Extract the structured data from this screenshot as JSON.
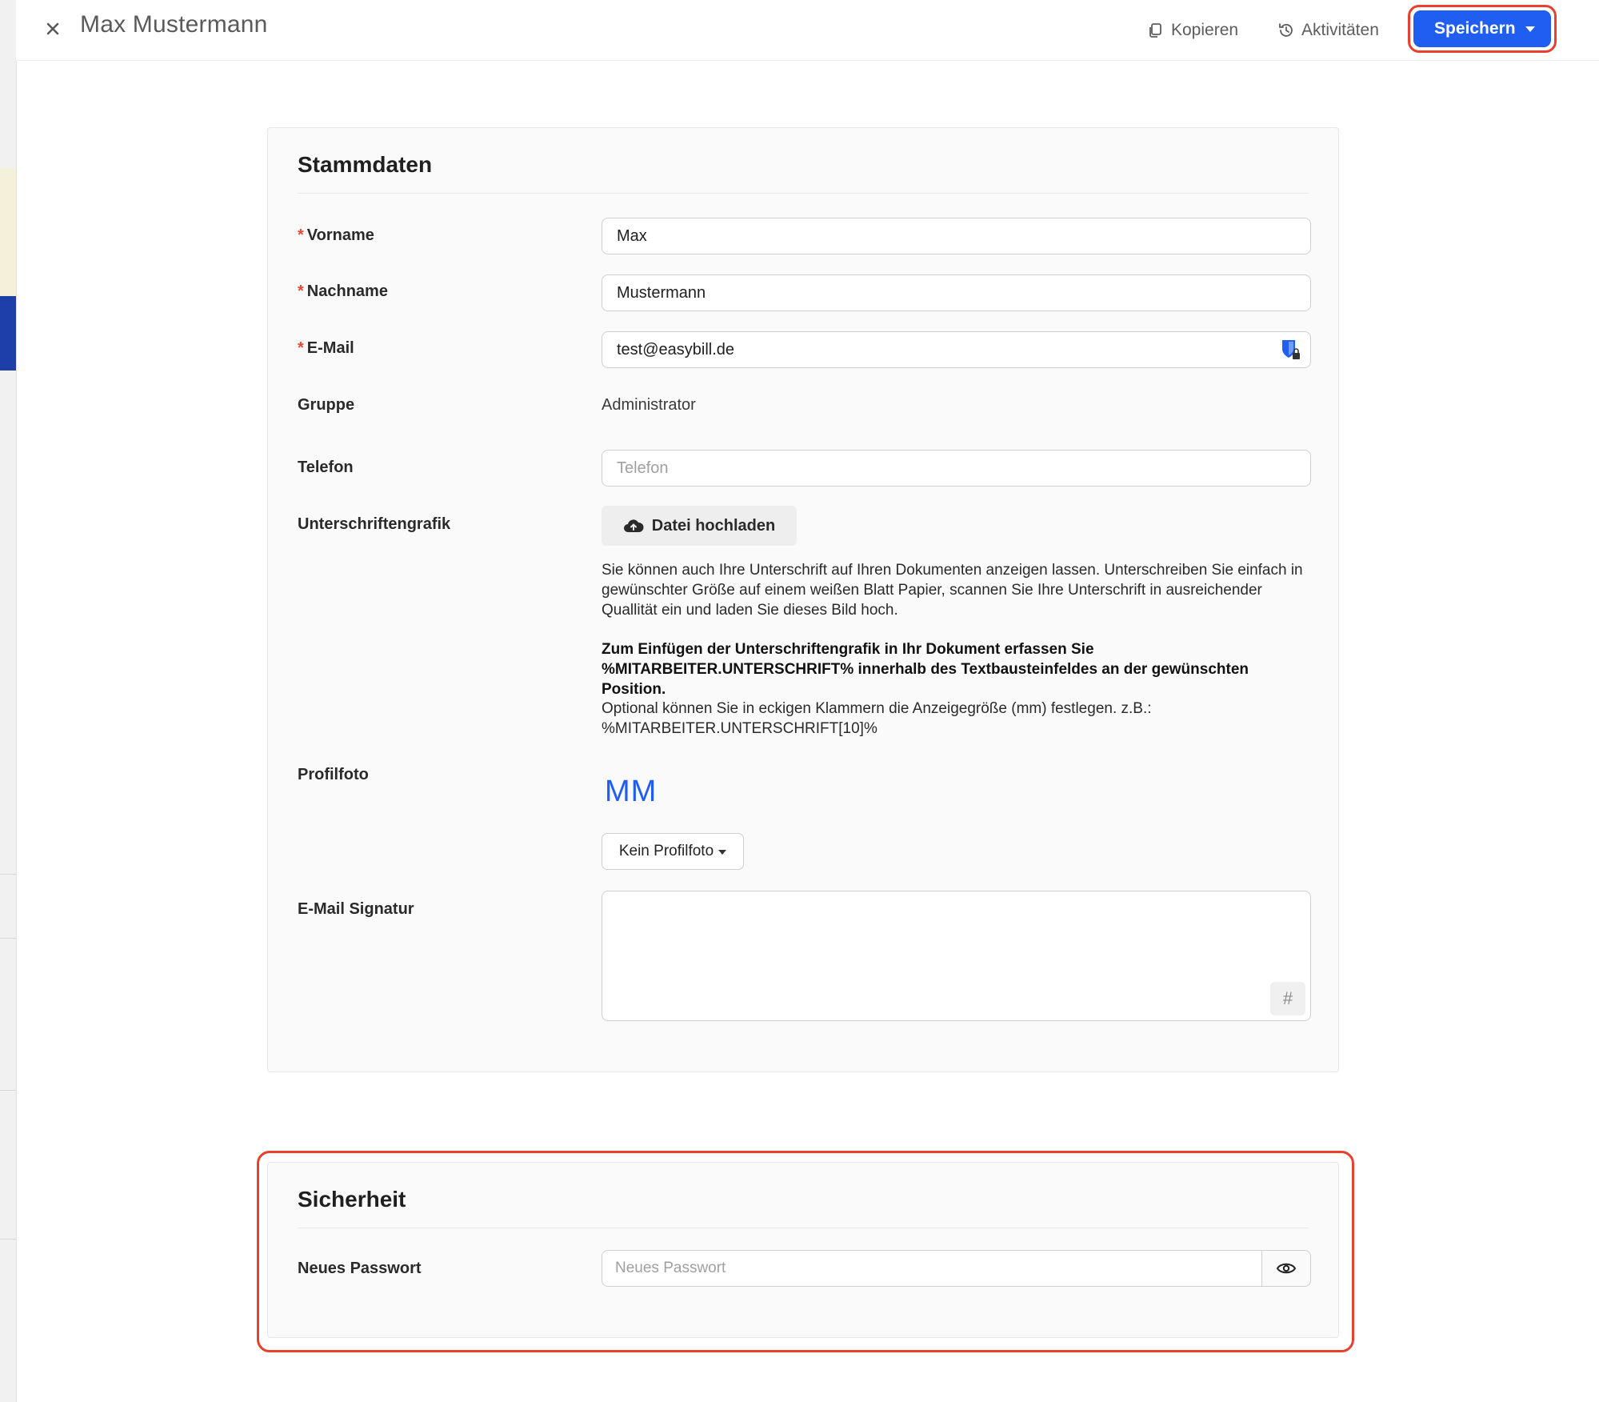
{
  "window": {
    "title": "Max Mustermann"
  },
  "toolbar": {
    "copy_label": "Kopieren",
    "activity_label": "Aktivitäten",
    "save_label": "Speichern"
  },
  "stammdaten": {
    "title": "Stammdaten",
    "required_marker": "*",
    "vorname": {
      "label": "Vorname",
      "value": "Max"
    },
    "nachname": {
      "label": "Nachname",
      "value": "Mustermann"
    },
    "email": {
      "label": "E-Mail",
      "value": "test@easybill.de"
    },
    "gruppe": {
      "label": "Gruppe",
      "value": "Administrator"
    },
    "telefon": {
      "label": "Telefon",
      "placeholder": "Telefon",
      "value": ""
    },
    "signature_graphic": {
      "label": "Unterschriftengrafik",
      "upload_label": "Datei hochladen",
      "help_text": "Sie können auch Ihre Unterschrift auf Ihren Dokumenten anzeigen lassen. Unterschreiben Sie einfach in gewünschter Größe auf einem weißen Blatt Papier, scannen Sie Ihre Unterschrift in ausreichender Quallität ein und laden Sie dieses Bild hoch.",
      "help_bold": "Zum Einfügen der Unterschriftengrafik in Ihr Dokument erfassen Sie %MITARBEITER.UNTERSCHRIFT% innerhalb des Textbausteinfeldes an der gewünschten Position.",
      "help_optional": "Optional können Sie in eckigen Klammern die Anzeigegröße (mm) festlegen. z.B.: %MITARBEITER.UNTERSCHRIFT[10]%"
    },
    "profilfoto": {
      "label": "Profilfoto",
      "initials": "MM",
      "dropdown_label": "Kein Profilfoto"
    },
    "email_signature": {
      "label": "E-Mail Signatur",
      "value": "",
      "hash_label": "#"
    }
  },
  "sicherheit": {
    "title": "Sicherheit",
    "password": {
      "label": "Neues Passwort",
      "placeholder": "Neues Passwort"
    }
  },
  "colors": {
    "accent": "#1f5ef0",
    "highlight": "#e8402e",
    "required": "#e34a35"
  },
  "icons": [
    "close-icon",
    "copy-icon",
    "history-icon",
    "chevron-down-icon",
    "password-manager-icon",
    "cloud-upload-icon",
    "eye-icon"
  ]
}
